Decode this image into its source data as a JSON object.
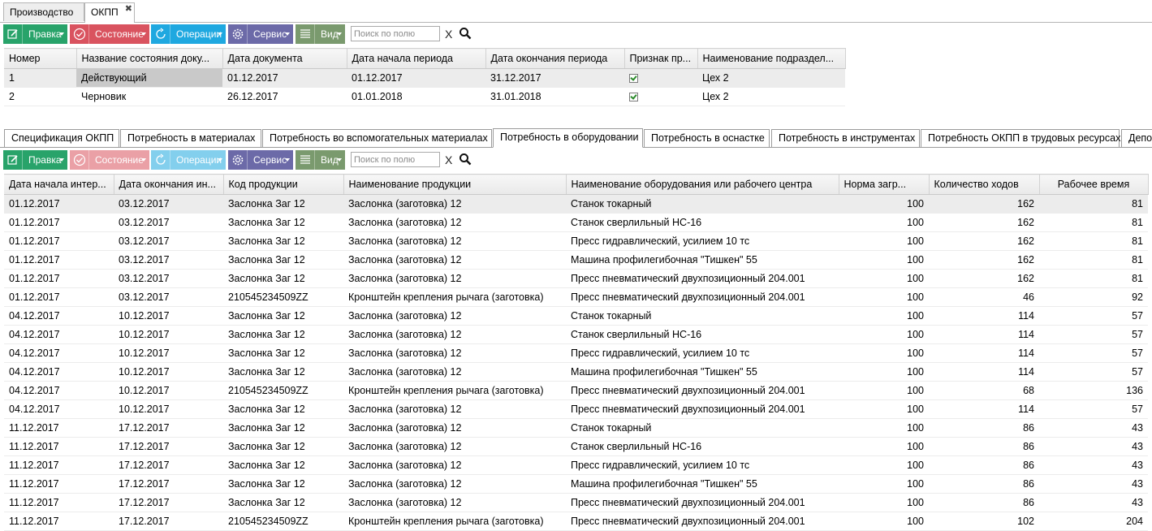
{
  "doc_tabs": [
    "Производство",
    "ОКПП"
  ],
  "toolbar": {
    "edit": "Правка",
    "state": "Состояние",
    "operations": "Операции",
    "service": "Сервис",
    "view": "Вид",
    "search_placeholder": "Поиск по полю",
    "clear": "X"
  },
  "top_grid": {
    "columns": [
      "Номер",
      "Название состояния доку...",
      "Дата документа",
      "Дата начала периода",
      "Дата окончания периода",
      "Признак пр...",
      "Наименование подраздел..."
    ],
    "rows": [
      [
        "1",
        "Действующий",
        "01.12.2017",
        "01.12.2017",
        "31.12.2017",
        "",
        "Цех 2"
      ],
      [
        "2",
        "Черновик",
        "26.12.2017",
        "01.01.2018",
        "31.01.2018",
        "",
        "Цех 2"
      ]
    ]
  },
  "sub_tabs": [
    "Спецификация ОКПП",
    "Потребность в материалах",
    "Потребность во вспомогательных материалах",
    "Потребность в оборудовании",
    "Потребность в оснастке",
    "Потребность в инструментах",
    "Потребность ОКПП в трудовых ресурсах",
    "Депо"
  ],
  "bottom_grid": {
    "columns": [
      "Дата начала интер...",
      "Дата окончания ин...",
      "Код продукции",
      "Наименование продукции",
      "Наименование оборудования или рабочего центра",
      "Норма загр...",
      "Количество ходов",
      "Рабочее время"
    ],
    "rows": [
      [
        "01.12.2017",
        "03.12.2017",
        "Заслонка Заг 12",
        "Заслонка (заготовка) 12",
        "Станок токарный",
        "100",
        "162",
        "81"
      ],
      [
        "01.12.2017",
        "03.12.2017",
        "Заслонка Заг 12",
        "Заслонка (заготовка) 12",
        "Станок сверлильный НС-16",
        "100",
        "162",
        "81"
      ],
      [
        "01.12.2017",
        "03.12.2017",
        "Заслонка Заг 12",
        "Заслонка (заготовка) 12",
        "Пресс гидравлический, усилием 10 тс",
        "100",
        "162",
        "81"
      ],
      [
        "01.12.2017",
        "03.12.2017",
        "Заслонка Заг 12",
        "Заслонка (заготовка) 12",
        "Машина профилегибочная \"Тишкен\" 55",
        "100",
        "162",
        "81"
      ],
      [
        "01.12.2017",
        "03.12.2017",
        "Заслонка Заг 12",
        "Заслонка (заготовка) 12",
        "Пресс пневматический двухпозиционный 204.001",
        "100",
        "162",
        "81"
      ],
      [
        "01.12.2017",
        "03.12.2017",
        "210545234509ZZ",
        "Кронштейн крепления рычага (заготовка)",
        "Пресс пневматический двухпозиционный 204.001",
        "100",
        "46",
        "92"
      ],
      [
        "04.12.2017",
        "10.12.2017",
        "Заслонка Заг 12",
        "Заслонка (заготовка) 12",
        "Станок токарный",
        "100",
        "114",
        "57"
      ],
      [
        "04.12.2017",
        "10.12.2017",
        "Заслонка Заг 12",
        "Заслонка (заготовка) 12",
        "Станок сверлильный НС-16",
        "100",
        "114",
        "57"
      ],
      [
        "04.12.2017",
        "10.12.2017",
        "Заслонка Заг 12",
        "Заслонка (заготовка) 12",
        "Пресс гидравлический, усилием 10 тс",
        "100",
        "114",
        "57"
      ],
      [
        "04.12.2017",
        "10.12.2017",
        "Заслонка Заг 12",
        "Заслонка (заготовка) 12",
        "Машина профилегибочная \"Тишкен\" 55",
        "100",
        "114",
        "57"
      ],
      [
        "04.12.2017",
        "10.12.2017",
        "210545234509ZZ",
        "Кронштейн крепления рычага (заготовка)",
        "Пресс пневматический двухпозиционный 204.001",
        "100",
        "68",
        "136"
      ],
      [
        "04.12.2017",
        "10.12.2017",
        "Заслонка Заг 12",
        "Заслонка (заготовка) 12",
        "Пресс пневматический двухпозиционный 204.001",
        "100",
        "114",
        "57"
      ],
      [
        "11.12.2017",
        "17.12.2017",
        "Заслонка Заг 12",
        "Заслонка (заготовка) 12",
        "Станок токарный",
        "100",
        "86",
        "43"
      ],
      [
        "11.12.2017",
        "17.12.2017",
        "Заслонка Заг 12",
        "Заслонка (заготовка) 12",
        "Станок сверлильный НС-16",
        "100",
        "86",
        "43"
      ],
      [
        "11.12.2017",
        "17.12.2017",
        "Заслонка Заг 12",
        "Заслонка (заготовка) 12",
        "Пресс гидравлический, усилием 10 тс",
        "100",
        "86",
        "43"
      ],
      [
        "11.12.2017",
        "17.12.2017",
        "Заслонка Заг 12",
        "Заслонка (заготовка) 12",
        "Машина профилегибочная \"Тишкен\" 55",
        "100",
        "86",
        "43"
      ],
      [
        "11.12.2017",
        "17.12.2017",
        "Заслонка Заг 12",
        "Заслонка (заготовка) 12",
        "Пресс пневматический двухпозиционный 204.001",
        "100",
        "86",
        "43"
      ],
      [
        "11.12.2017",
        "17.12.2017",
        "210545234509ZZ",
        "Кронштейн крепления рычага (заготовка)",
        "Пресс пневматический двухпозиционный 204.001",
        "100",
        "102",
        "204"
      ]
    ]
  },
  "colors": {
    "edit": "#28a36a",
    "state": "#d9535f",
    "operations": "#1fa8e0",
    "service": "#6c6aa8",
    "view": "#7a9a6e"
  }
}
